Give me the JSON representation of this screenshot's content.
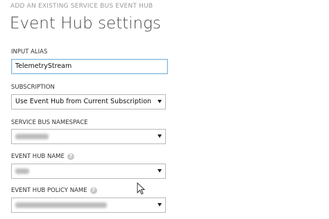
{
  "header": {
    "overline": "ADD AN EXISTING SERVICE BUS EVENT HUB",
    "title": "Event Hub settings"
  },
  "fields": {
    "input_alias": {
      "label": "INPUT ALIAS",
      "value": "TelemetryStream"
    },
    "subscription": {
      "label": "SUBSCRIPTION",
      "selected": "Use Event Hub from Current Subscription"
    },
    "service_bus_namespace": {
      "label": "SERVICE BUS NAMESPACE"
    },
    "event_hub_name": {
      "label": "EVENT HUB NAME"
    },
    "event_hub_policy_name": {
      "label": "EVENT HUB POLICY NAME"
    }
  },
  "icons": {
    "help": "help-icon",
    "dropdown": "chevron-down-icon",
    "cursor": "mouse-pointer-icon"
  },
  "colors": {
    "focus_border": "#84b7dd",
    "field_border": "#b9b9b9",
    "title_text": "#4a4a4a",
    "overline_text": "#9a9a9a"
  }
}
